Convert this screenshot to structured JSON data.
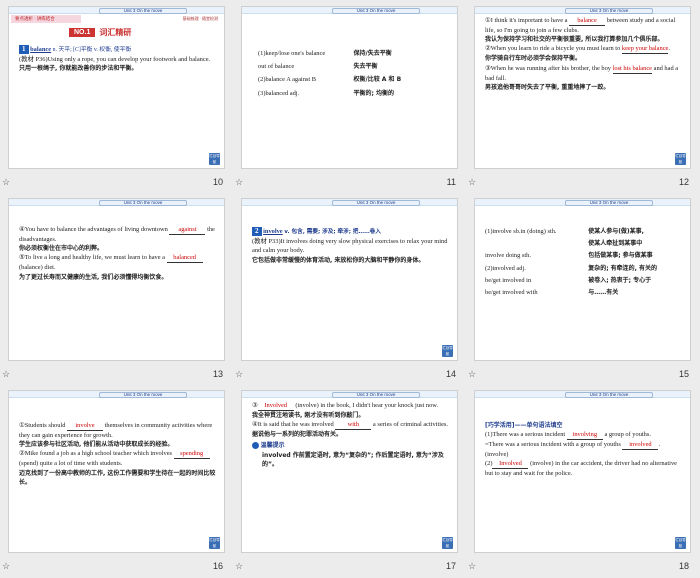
{
  "slides": [
    {
      "num": "10",
      "unit": "Unit 3  On the move",
      "top": "要点透析 · 讲练结合",
      "right": "基础梳理 · 随堂检测",
      "head_num": "NO.1",
      "head_title": "词汇精研",
      "word": "balance",
      "pos": "n. 天平; [C]平衡  v. 权衡, 使平衡",
      "ex": "(教材 P36)Using only a rope, you can develop your footwork and balance.",
      "cn": "只用一根绳子, 你就能改善你的步法和平衡。",
      "nav": "栏目导航"
    },
    {
      "num": "11",
      "unit": "Unit 3  On the move",
      "rows": [
        [
          "(1)keep/lose one's balance",
          "保持/失去平衡"
        ],
        [
          "out of balance",
          "失去平衡"
        ],
        [
          "(2)balance A against B",
          "权衡/比较 A 和 B"
        ],
        [
          "(3)balanced adj.",
          "平衡的; 均衡的"
        ]
      ]
    },
    {
      "num": "12",
      "unit": "Unit 3  On the move",
      "l1": "①I think it's important to have a",
      "b1": "balance",
      "l1b": "between study and a social life, so I'm going to join a few clubs.",
      "c1": "我认为保持学习和社交的平衡很重要, 所以我打算参加几个俱乐部。",
      "l2": "②When you learn to ride a bicycle you must learn to",
      "b2": "keep your balance",
      "c2": "你学骑自行车时必须学会保持平衡。",
      "l3": "③When he was running after his brother, the boy",
      "b3": "lost his balance",
      "l3b": "and had a bad fall.",
      "c3": "男孩追他哥哥时失去了平衡, 重重地摔了一跤。",
      "nav": "栏目导航"
    },
    {
      "num": "13",
      "unit": "Unit 3  On the move",
      "l1": "④You have to balance the advantages of living downtown",
      "b1": "against",
      "l1b": "the disadvantages.",
      "c1": "你必须权衡住在市中心的利弊。",
      "l2": "⑤To live a long and healthy life, we must learn to have a",
      "b2": "balanced",
      "l2b": "(balance) diet.",
      "c2": "为了更过长寿而又健康的生活, 我们必须懂得均衡饮食。"
    },
    {
      "num": "14",
      "unit": "Unit 3  On the move",
      "word": "involve",
      "pos": "v. 包含, 需要; 涉及; 牵涉; 把……卷入",
      "ex": "(教材 P33)It involves doing very slow physical exercises to relax your mind and calm your body.",
      "cn": "它包括做非常缓慢的体育活动, 来放松你的大脑和平静你的身体。",
      "nav": "栏目导航"
    },
    {
      "num": "15",
      "unit": "Unit 3  On the move",
      "rows": [
        [
          "(1)involve sb.in (doing) sth.",
          "使某人参与(做)某事,"
        ],
        [
          "",
          "使某人牵扯到某事中"
        ],
        [
          "involve doing sth.",
          "包括做某事; 参与做某事"
        ],
        [
          "(2)involved adj.",
          "复杂的; 有牵连的, 有关的"
        ],
        [
          "be/get involved in",
          "被卷入; 热衷于; 专心于"
        ],
        [
          "be/get involved with",
          "与……有关"
        ]
      ]
    },
    {
      "num": "16",
      "unit": "Unit 3  On the move",
      "l1": "①Students should",
      "b1": "involve",
      "l1b": "themselves in community activities where they can gain experience for growth.",
      "c1": "学生应该参与社区活动, 他们能从活动中获取成长的经验。",
      "l2": "②Mike found a job as a high school teacher which involves",
      "b2": "spending",
      "l2b": "(spend) quite a lot of time with students.",
      "c2": "迈克找到了一份高中教师的工作, 这份工作需要和学生待在一起的时间比较长。",
      "nav": "栏目导航"
    },
    {
      "num": "17",
      "unit": "Unit 3  On the move",
      "b1": "Involved",
      "l1b": "(involve) in the book, I didn't hear your knock just now.",
      "c1": "我全神贯注地读书, 刚才没有听到你敲门。",
      "l2": "④It is said that he was involved",
      "b2": "with",
      "l2b": "a series of criminal activities.",
      "c2": "据说他与一系列的犯罪活动有关。",
      "tip": "温馨提示",
      "tiptext": "involved 作前置定语时, 意为“复杂的”; 作后置定语时, 意为“涉及的”。",
      "nav": "栏目导航"
    },
    {
      "num": "18",
      "unit": "Unit 3  On the move",
      "title": "[巧学活用]——单句语法填空",
      "l1": "(1)There was a serious incident",
      "b1": "involving",
      "l1b": "a group of youths.",
      "l2": "=There was a serious incident with a group of youths",
      "b2": "involved",
      "l2b": ". (involve)",
      "l3": "(2)",
      "b3": "Involved",
      "l3b": "(involve) in the car accident, the driver had no alternative but to stay and wait for the police.",
      "nav": "栏目导航"
    }
  ]
}
